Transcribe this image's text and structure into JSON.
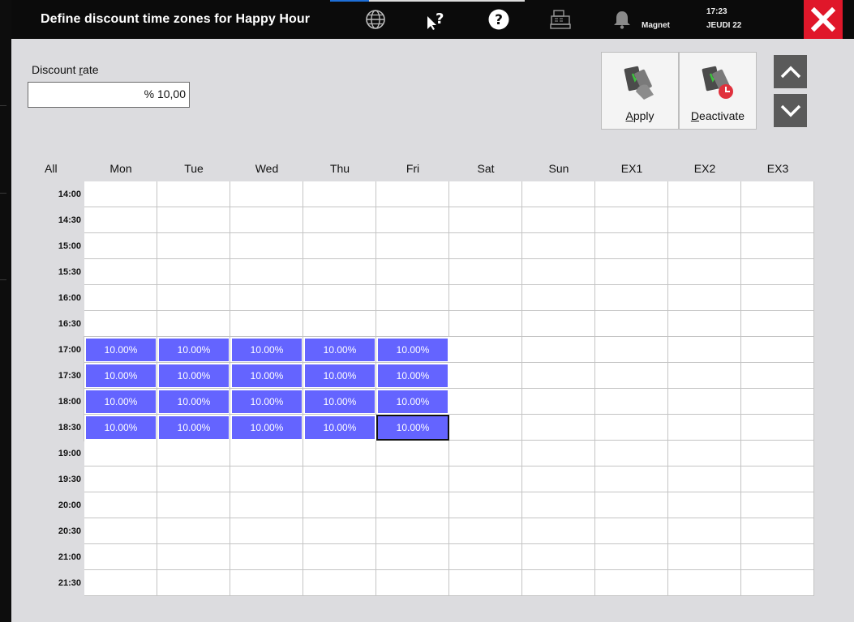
{
  "window": {
    "title": "Define discount time zones for Happy Hour",
    "user": "Magnet",
    "time": "17:23",
    "date": "JEUDI 22"
  },
  "discount": {
    "label_prefix": "Discount ",
    "label_underlined": "r",
    "label_suffix": "ate",
    "value": "% 10,00"
  },
  "actions": {
    "apply_underlined": "A",
    "apply_rest": "pply",
    "deactivate_underlined": "D",
    "deactivate_rest": "eactivate"
  },
  "grid": {
    "all_label": "All",
    "columns": [
      "Mon",
      "Tue",
      "Wed",
      "Thu",
      "Fri",
      "Sat",
      "Sun",
      "EX1",
      "EX2",
      "EX3"
    ],
    "rows": [
      "14:00",
      "14:30",
      "15:00",
      "15:30",
      "16:00",
      "16:30",
      "17:00",
      "17:30",
      "18:00",
      "18:30",
      "19:00",
      "19:30",
      "20:00",
      "20:30",
      "21:00",
      "21:30"
    ],
    "active_value": "10.00%",
    "active_rows": [
      6,
      7,
      8,
      9
    ],
    "active_cols": [
      0,
      1,
      2,
      3,
      4
    ],
    "selected": {
      "row": 9,
      "col": 4
    }
  },
  "colors": {
    "active_cell": "#6464ff",
    "close_button": "#e0172a",
    "panel": "#dcdcdf"
  },
  "icons": [
    "globe-icon",
    "help-pointer-icon",
    "help-circle-icon",
    "cash-register-icon",
    "bell-icon",
    "close-icon",
    "chevron-up-icon",
    "chevron-down-icon",
    "apply-discount-icon",
    "deactivate-discount-icon"
  ]
}
